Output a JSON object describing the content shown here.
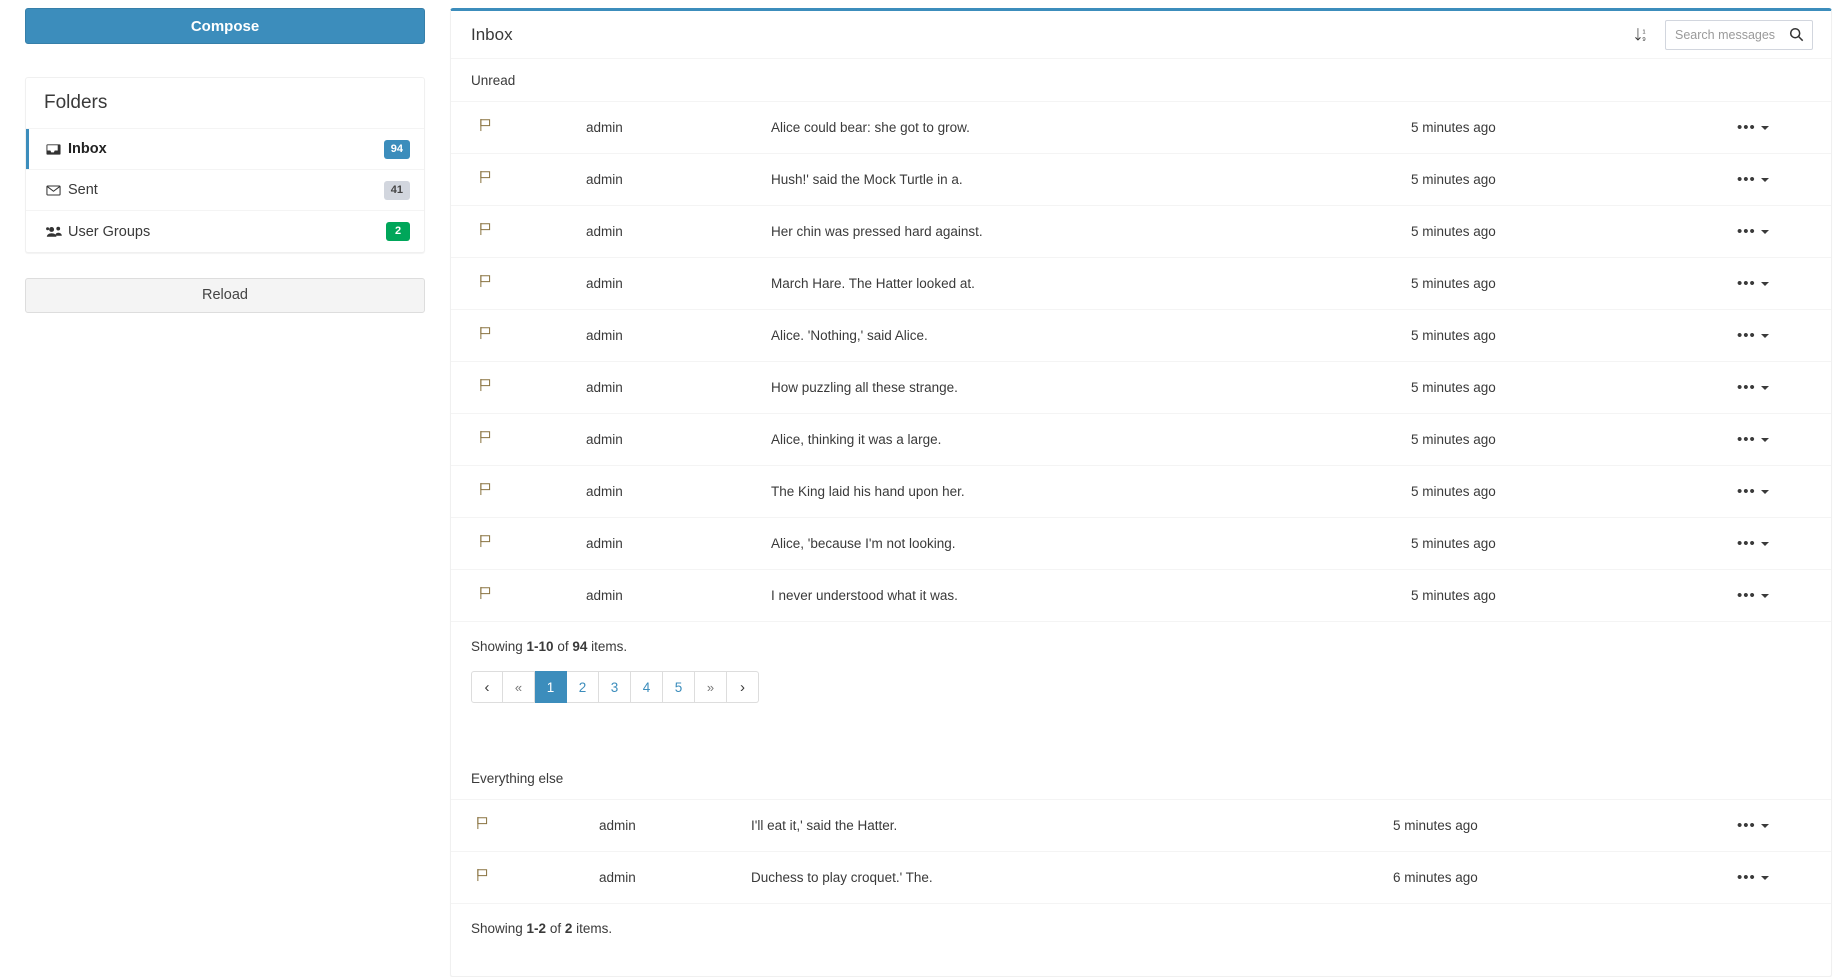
{
  "sidebar": {
    "compose_label": "Compose",
    "folders_title": "Folders",
    "reload_label": "Reload",
    "items": [
      {
        "label": "Inbox",
        "icon": "inbox-icon",
        "badge": "94",
        "badge_style": "primary",
        "active": true
      },
      {
        "label": "Sent",
        "icon": "envelope-icon",
        "badge": "41",
        "badge_style": "default",
        "active": false
      },
      {
        "label": "User Groups",
        "icon": "users-icon",
        "badge": "2",
        "badge_style": "success",
        "active": false
      }
    ]
  },
  "header": {
    "title": "Inbox",
    "sort_icon": "sort-numeric-down-icon",
    "search_placeholder": "Search messages",
    "search_value": "",
    "search_icon": "search-icon"
  },
  "groups": [
    {
      "label": "Unread",
      "rows": [
        {
          "flag": "flag-icon",
          "from": "admin",
          "subject": "Alice could bear: she got to grow.",
          "time": "5 minutes ago",
          "menu": "ellipsis-caret-icon"
        },
        {
          "flag": "flag-icon",
          "from": "admin",
          "subject": "Hush!' said the Mock Turtle in a.",
          "time": "5 minutes ago",
          "menu": "ellipsis-caret-icon"
        },
        {
          "flag": "flag-icon",
          "from": "admin",
          "subject": "Her chin was pressed hard against.",
          "time": "5 minutes ago",
          "menu": "ellipsis-caret-icon"
        },
        {
          "flag": "flag-icon",
          "from": "admin",
          "subject": "March Hare. The Hatter looked at.",
          "time": "5 minutes ago",
          "menu": "ellipsis-caret-icon"
        },
        {
          "flag": "flag-icon",
          "from": "admin",
          "subject": "Alice. 'Nothing,' said Alice.",
          "time": "5 minutes ago",
          "menu": "ellipsis-caret-icon"
        },
        {
          "flag": "flag-icon",
          "from": "admin",
          "subject": "How puzzling all these strange.",
          "time": "5 minutes ago",
          "menu": "ellipsis-caret-icon"
        },
        {
          "flag": "flag-icon",
          "from": "admin",
          "subject": "Alice, thinking it was a large.",
          "time": "5 minutes ago",
          "menu": "ellipsis-caret-icon"
        },
        {
          "flag": "flag-icon",
          "from": "admin",
          "subject": "The King laid his hand upon her.",
          "time": "5 minutes ago",
          "menu": "ellipsis-caret-icon"
        },
        {
          "flag": "flag-icon",
          "from": "admin",
          "subject": "Alice, 'because I'm not looking.",
          "time": "5 minutes ago",
          "menu": "ellipsis-caret-icon"
        },
        {
          "flag": "flag-icon",
          "from": "admin",
          "subject": "I never understood what it was.",
          "time": "5 minutes ago",
          "menu": "ellipsis-caret-icon"
        }
      ],
      "summary": {
        "prefix": "Showing ",
        "range": "1-10",
        "middle": " of ",
        "total": "94",
        "suffix": " items."
      },
      "pagination": {
        "prev_arrow": "‹",
        "first": "«",
        "pages": [
          "1",
          "2",
          "3",
          "4",
          "5"
        ],
        "active_page": "1",
        "last": "»",
        "next_arrow": "›"
      }
    },
    {
      "label": "Everything else",
      "rows": [
        {
          "flag": "flag-icon",
          "from": "admin",
          "subject": "I'll eat it,' said the Hatter.",
          "time": "5 minutes ago",
          "menu": "ellipsis-caret-icon"
        },
        {
          "flag": "flag-icon",
          "from": "admin",
          "subject": "Duchess to play croquet.' The.",
          "time": "6 minutes ago",
          "menu": "ellipsis-caret-icon"
        }
      ],
      "summary": {
        "prefix": "Showing ",
        "range": "1-2",
        "middle": " of ",
        "total": "2",
        "suffix": " items."
      }
    }
  ],
  "colors": {
    "accent": "#3c8dbc",
    "success": "#00a65a",
    "default_badge": "#d2d6de",
    "flag": "#8a7340",
    "text": "#3a3a3a"
  }
}
